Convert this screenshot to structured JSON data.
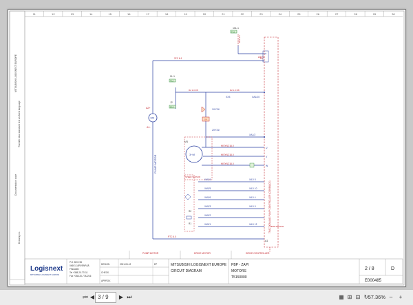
{
  "sheet": {
    "columns": [
      "11",
      "12",
      "13",
      "14",
      "15",
      "16",
      "17",
      "18",
      "19",
      "20",
      "21",
      "22",
      "23",
      "24",
      "25",
      "26",
      "27",
      "28",
      "29",
      "30"
    ],
    "top_refs": {
      "f10": "10L.1",
      "f10b": "F10",
      "f12": "2L.1",
      "f12b": "F12",
      "j2": "J2",
      "j2b": "E18",
      "x6": "2FC 6:1"
    },
    "labels": {
      "m2_plus": "A2+",
      "m2": "M2",
      "m2_minus": "A1-",
      "pump_motor": "PUMP MOTOR",
      "a1f1": "A1F1",
      "xa1_10": "XA1/10",
      "xa1_2": "XA1/2",
      "x3y1_1": "1XY31/",
      "x3y1_2": "2XY31/",
      "xx3": "XX3",
      "m1": "M1",
      "speed_sensor": "SPEED SENSOR",
      "r2": "R2",
      "r1": "R1",
      "xm2": "XM1/2",
      "xm1": "XM1/1",
      "xm3": "XM1/3",
      "xm4": "XM1/4",
      "xm5": "XM1/5",
      "xm6": "XM1/6",
      "xa1_8": "XA1/ 8",
      "xa1_10b": "XA1/ 10",
      "xa1_4": "XA1/ 4",
      "xa1_5": "XA1/ 5",
      "xa1_12": "XA1/ 12",
      "a1": "A1",
      "temp_sensor": "TEMP SENSOR",
      "traction_ctrl": "TRACTION AND PUMP CONTROLLER (COMBIACX)",
      "u": "U",
      "v": "V",
      "w": "W",
      "hisyn1": "HISYN2 16.0",
      "hisyn2": "HISYN2 16.0",
      "hisyn3": "HISYN2 16.0",
      "b_plus": "B+",
      "p_plus": "P+",
      "ptc": "PTC 6.0",
      "bottom_b": "B+"
    },
    "sections": [
      "PUMP MOTOR",
      "DRIVE MOTOR",
      "DRIVE CONTROLLER"
    ],
    "left_margin_text": [
      "MITSUBISHI LOGISNEXT EUROPE",
      "Transfer also standard text as fixed language",
      "Documentation code",
      "Drawing no."
    ],
    "title_block": {
      "logo": "Logisnext",
      "logo_sub": "MITSUBISHI LOGISNEXT EUROPE",
      "address": [
        "P.O. BOX 55",
        "04601 JÄRVENPÄÄ",
        "FINLAND",
        "Tel +358-20-77411",
        "Fax +358-20-7742216"
      ],
      "rows": [
        [
          "DESIGN",
          "2021-05-12",
          "EP"
        ],
        [
          "CHECK.",
          "",
          ""
        ],
        [
          "APPROV.",
          "",
          ""
        ]
      ],
      "company": "MITSUBISHI LOGISNEXT EUROPE",
      "doc_type": "CIRCUIT DIAGRAM",
      "model": "PBP - ZAPI",
      "subject": "MOTORS",
      "code": "T5150000",
      "page": "2 / 8",
      "revision": "D",
      "drawing_no": "E000485"
    }
  },
  "viewer": {
    "page_value": "3 / 9",
    "zoom": "57.36%"
  },
  "colors": {
    "wire": "#2a3fa0",
    "hot": "#c4262e",
    "frame": "#9a9a9a",
    "green": "#2e8b3a"
  }
}
